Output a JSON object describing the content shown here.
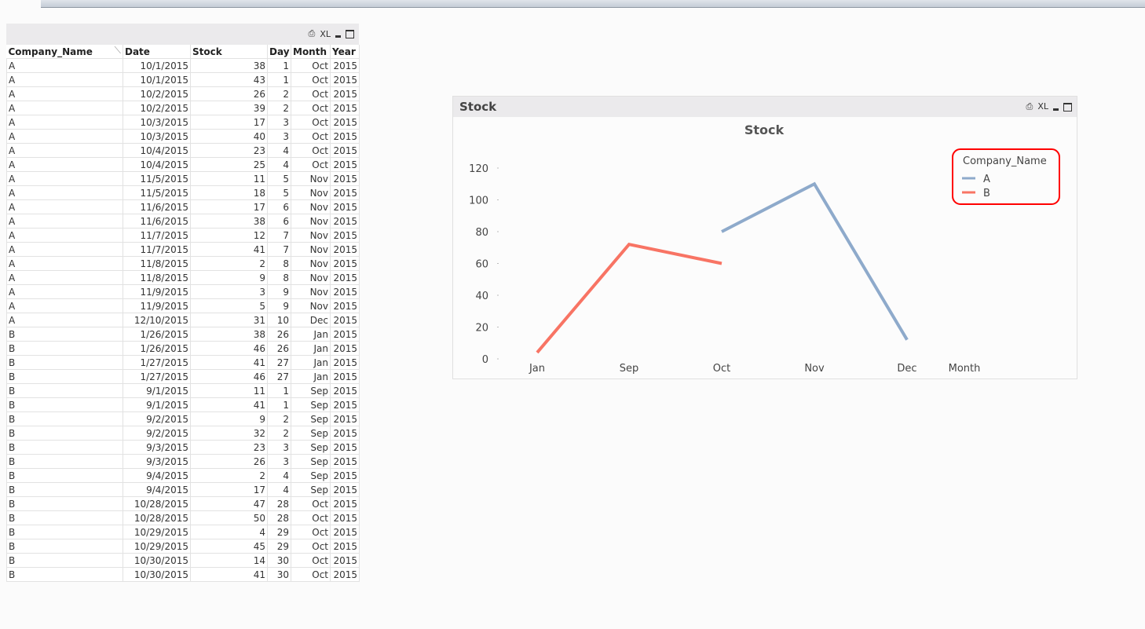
{
  "table": {
    "icons": [
      "print-icon",
      "xl-export-icon",
      "minimize-icon",
      "maximize-icon"
    ],
    "xl_label": "XL",
    "columns": [
      "Company_Name",
      "Date",
      "Stock",
      "Day",
      "Month",
      "Year"
    ],
    "rows": [
      [
        "A",
        "10/1/2015",
        "38",
        "1",
        "Oct",
        "2015"
      ],
      [
        "A",
        "10/1/2015",
        "43",
        "1",
        "Oct",
        "2015"
      ],
      [
        "A",
        "10/2/2015",
        "26",
        "2",
        "Oct",
        "2015"
      ],
      [
        "A",
        "10/2/2015",
        "39",
        "2",
        "Oct",
        "2015"
      ],
      [
        "A",
        "10/3/2015",
        "17",
        "3",
        "Oct",
        "2015"
      ],
      [
        "A",
        "10/3/2015",
        "40",
        "3",
        "Oct",
        "2015"
      ],
      [
        "A",
        "10/4/2015",
        "23",
        "4",
        "Oct",
        "2015"
      ],
      [
        "A",
        "10/4/2015",
        "25",
        "4",
        "Oct",
        "2015"
      ],
      [
        "A",
        "11/5/2015",
        "11",
        "5",
        "Nov",
        "2015"
      ],
      [
        "A",
        "11/5/2015",
        "18",
        "5",
        "Nov",
        "2015"
      ],
      [
        "A",
        "11/6/2015",
        "17",
        "6",
        "Nov",
        "2015"
      ],
      [
        "A",
        "11/6/2015",
        "38",
        "6",
        "Nov",
        "2015"
      ],
      [
        "A",
        "11/7/2015",
        "12",
        "7",
        "Nov",
        "2015"
      ],
      [
        "A",
        "11/7/2015",
        "41",
        "7",
        "Nov",
        "2015"
      ],
      [
        "A",
        "11/8/2015",
        "2",
        "8",
        "Nov",
        "2015"
      ],
      [
        "A",
        "11/8/2015",
        "9",
        "8",
        "Nov",
        "2015"
      ],
      [
        "A",
        "11/9/2015",
        "3",
        "9",
        "Nov",
        "2015"
      ],
      [
        "A",
        "11/9/2015",
        "5",
        "9",
        "Nov",
        "2015"
      ],
      [
        "A",
        "12/10/2015",
        "31",
        "10",
        "Dec",
        "2015"
      ],
      [
        "B",
        "1/26/2015",
        "38",
        "26",
        "Jan",
        "2015"
      ],
      [
        "B",
        "1/26/2015",
        "46",
        "26",
        "Jan",
        "2015"
      ],
      [
        "B",
        "1/27/2015",
        "41",
        "27",
        "Jan",
        "2015"
      ],
      [
        "B",
        "1/27/2015",
        "46",
        "27",
        "Jan",
        "2015"
      ],
      [
        "B",
        "9/1/2015",
        "11",
        "1",
        "Sep",
        "2015"
      ],
      [
        "B",
        "9/1/2015",
        "41",
        "1",
        "Sep",
        "2015"
      ],
      [
        "B",
        "9/2/2015",
        "9",
        "2",
        "Sep",
        "2015"
      ],
      [
        "B",
        "9/2/2015",
        "32",
        "2",
        "Sep",
        "2015"
      ],
      [
        "B",
        "9/3/2015",
        "23",
        "3",
        "Sep",
        "2015"
      ],
      [
        "B",
        "9/3/2015",
        "26",
        "3",
        "Sep",
        "2015"
      ],
      [
        "B",
        "9/4/2015",
        "2",
        "4",
        "Sep",
        "2015"
      ],
      [
        "B",
        "9/4/2015",
        "17",
        "4",
        "Sep",
        "2015"
      ],
      [
        "B",
        "10/28/2015",
        "47",
        "28",
        "Oct",
        "2015"
      ],
      [
        "B",
        "10/28/2015",
        "50",
        "28",
        "Oct",
        "2015"
      ],
      [
        "B",
        "10/29/2015",
        "4",
        "29",
        "Oct",
        "2015"
      ],
      [
        "B",
        "10/29/2015",
        "45",
        "29",
        "Oct",
        "2015"
      ],
      [
        "B",
        "10/30/2015",
        "14",
        "30",
        "Oct",
        "2015"
      ],
      [
        "B",
        "10/30/2015",
        "41",
        "30",
        "Oct",
        "2015"
      ]
    ]
  },
  "chart_window": {
    "caption": "Stock",
    "xl_label": "XL"
  },
  "chart_data": {
    "type": "line",
    "title": "Stock",
    "xlabel": "Month",
    "ylabel": "",
    "categories": [
      "Jan",
      "Sep",
      "Oct",
      "Nov",
      "Dec"
    ],
    "ylim": [
      0,
      120
    ],
    "yticks": [
      0,
      20,
      40,
      60,
      80,
      100,
      120
    ],
    "legend": {
      "title": "Company_Name",
      "placement": "top-right",
      "highlight_color": "#ff0000"
    },
    "series": [
      {
        "name": "A",
        "color": "#8eaacb",
        "values": [
          null,
          null,
          80,
          110,
          12
        ]
      },
      {
        "name": "B",
        "color": "#f87464",
        "values": [
          4,
          72,
          60,
          null,
          null
        ]
      }
    ]
  }
}
